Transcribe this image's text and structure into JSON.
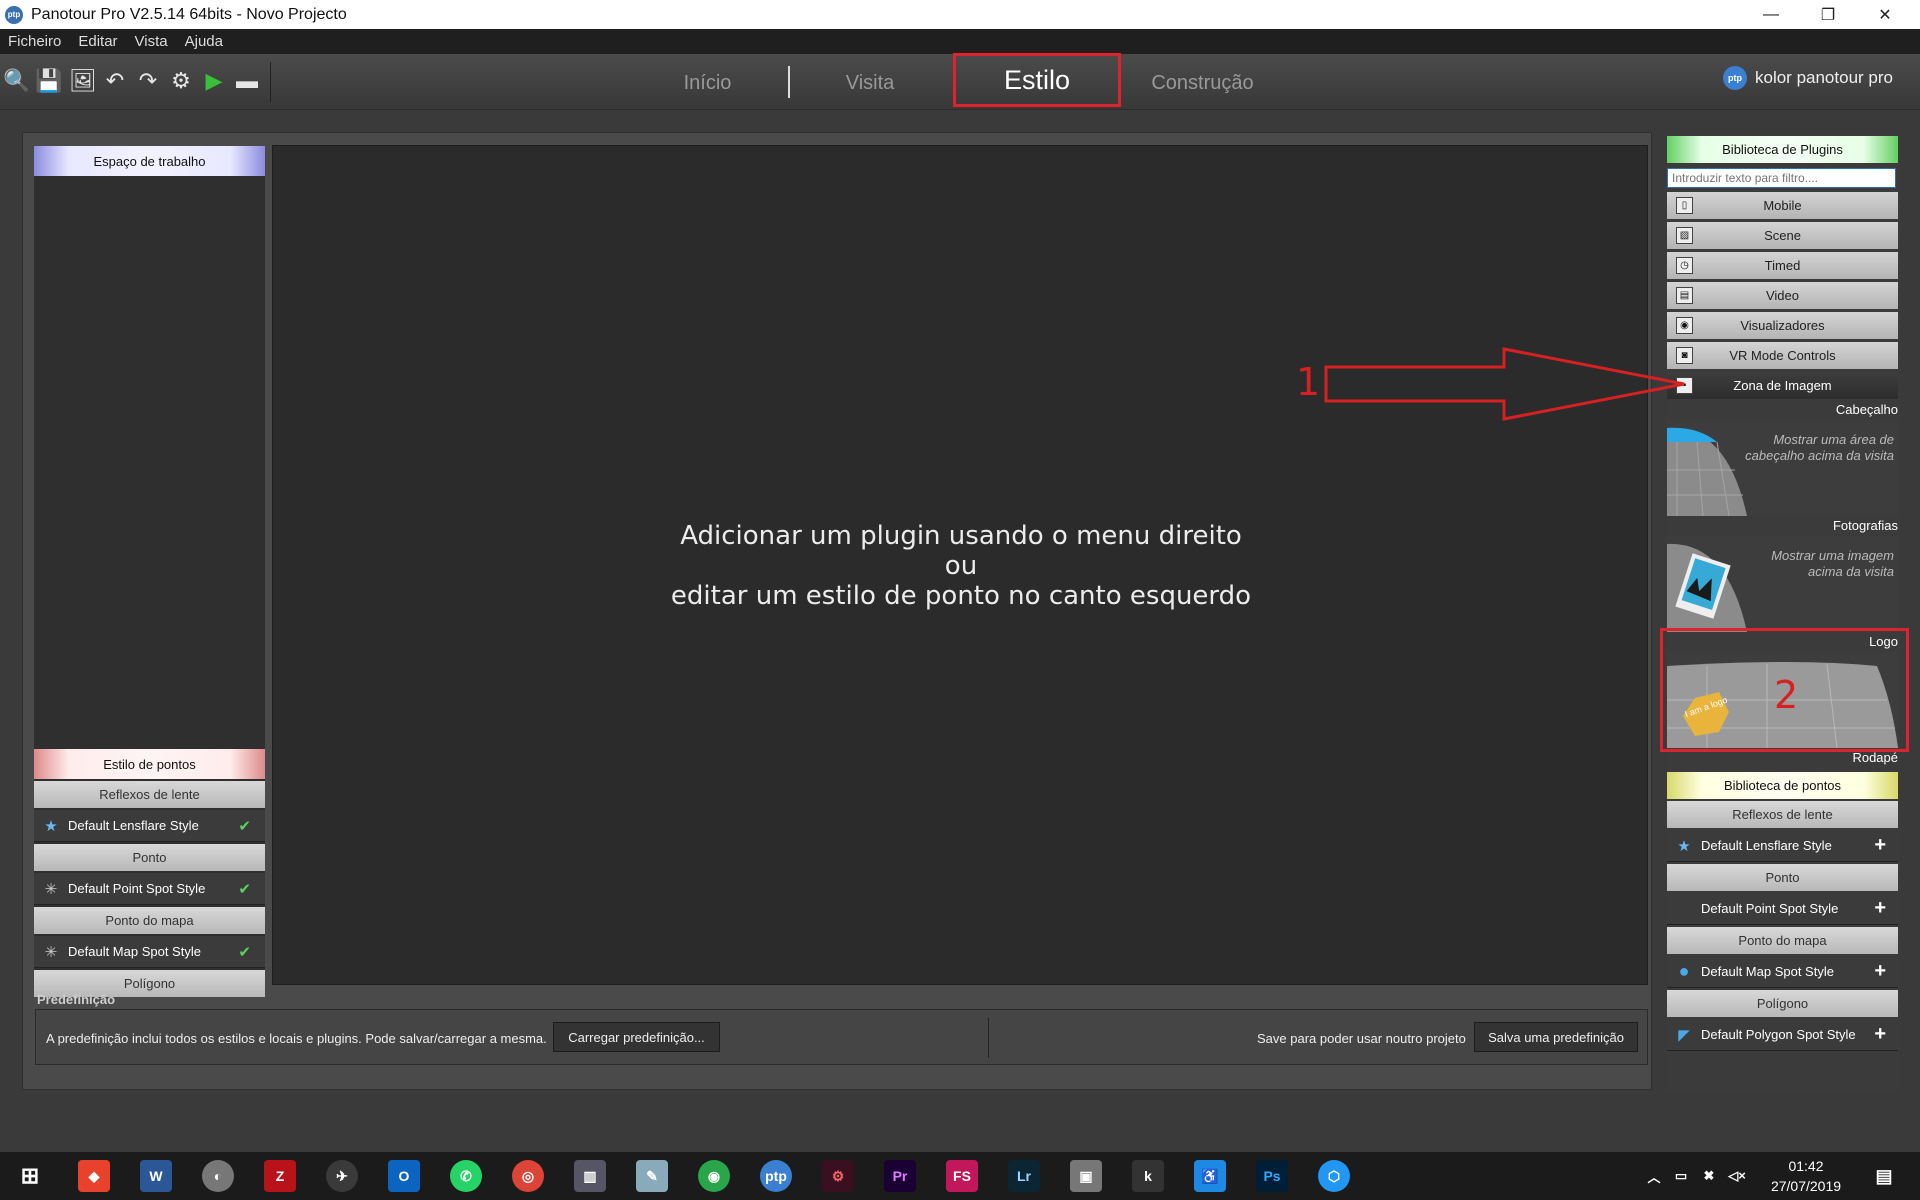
{
  "window": {
    "title": "Panotour Pro V2.5.14 64bits - Novo Projecto",
    "minimize": "—",
    "restore": "❐",
    "close": "✕"
  },
  "menu": [
    "Ficheiro",
    "Editar",
    "Vista",
    "Ajuda"
  ],
  "nav": {
    "tabs": [
      "Início",
      "Visita",
      "Estilo",
      "Construção"
    ],
    "active": "Estilo"
  },
  "brand": {
    "logo": "ptp",
    "name": "kolor panotour pro"
  },
  "left": {
    "workspace_header": "Espaço de trabalho",
    "spot_header": "Estilo de pontos",
    "categories": [
      "Reflexos de lente",
      "Ponto",
      "Ponto do mapa",
      "Polígono"
    ],
    "items": [
      "Default Lensflare Style",
      "Default Point Spot Style",
      "Default Map Spot Style"
    ]
  },
  "canvas": {
    "line1": "Adicionar um plugin usando o menu direito",
    "line2": "ou",
    "line3": "editar um estilo de ponto no canto esquerdo"
  },
  "preset": {
    "label": "Predefinição",
    "description": "A predefinição inclui todos os estilos e locais e plugins. Pode salvar/carregar a mesma.",
    "load_button": "Carregar predefinição...",
    "save_hint": "Save para poder usar noutro projeto",
    "save_button": "Salva uma predefinição"
  },
  "plugins": {
    "header": "Biblioteca de Plugins",
    "filter_placeholder": "Introduzir texto para filtro....",
    "groups": [
      "Mobile",
      "Scene",
      "Timed",
      "Video",
      "Visualizadores",
      "VR Mode Controls",
      "Zona de Imagem"
    ],
    "thumbs": [
      {
        "label": "Cabeçalho",
        "desc": "Mostrar uma área de cabeçalho acima da visita"
      },
      {
        "label": "Fotografias",
        "desc": "Mostrar uma imagem acima da visita"
      },
      {
        "label": "Logo",
        "desc": "",
        "badge": "I am a logo"
      }
    ],
    "footer_label": "Rodapé"
  },
  "spots": {
    "header": "Biblioteca de pontos",
    "categories": [
      "Reflexos de lente",
      "Ponto",
      "Ponto do mapa",
      "Polígono"
    ],
    "items": [
      "Default Lensflare Style",
      "Default Point Spot Style",
      "Default Map Spot Style",
      "Default Polygon Spot Style"
    ]
  },
  "annotations": [
    "1",
    "2"
  ],
  "taskbar": {
    "apps": [
      "Pr",
      "FS",
      "Lr",
      "Ps"
    ],
    "time": "01:42",
    "date": "27/07/2019"
  },
  "colors": {
    "accent_red": "#e0222e",
    "check_green": "#5bd25b"
  }
}
